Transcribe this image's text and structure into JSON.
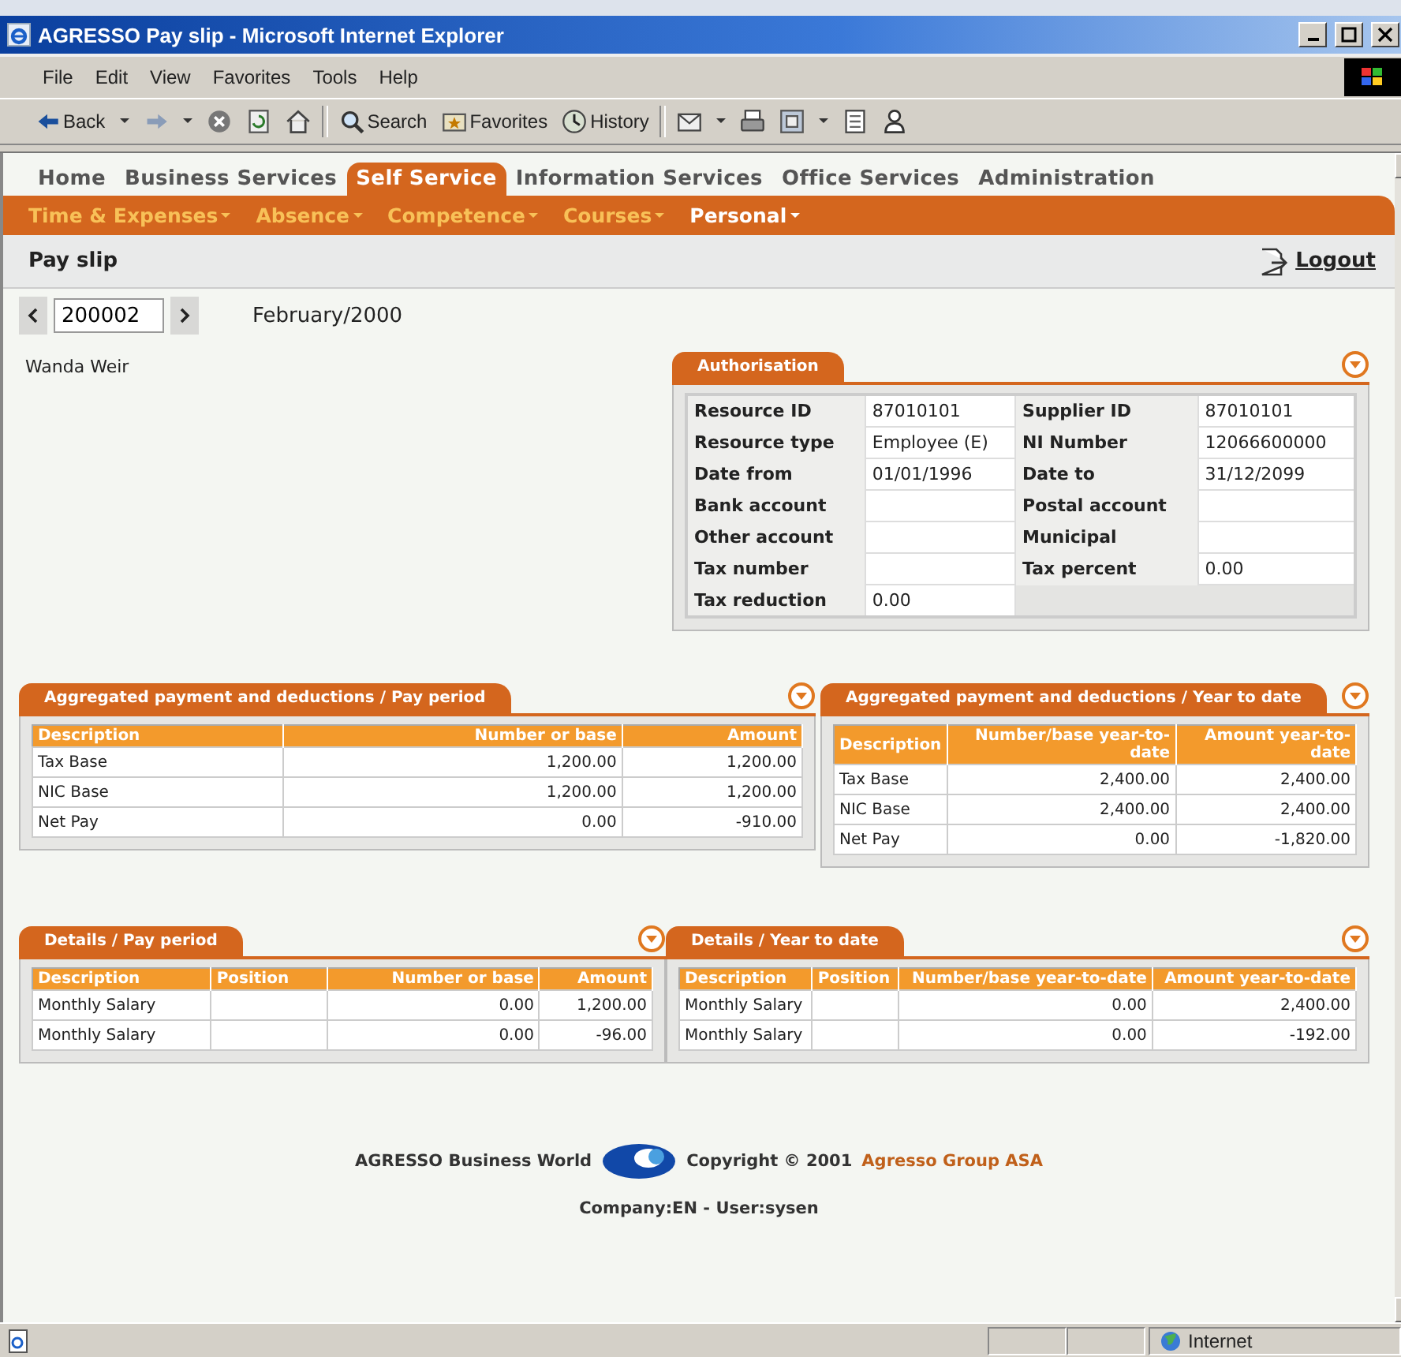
{
  "window": {
    "title": "AGRESSO Pay slip - Microsoft Internet Explorer"
  },
  "menu": [
    "File",
    "Edit",
    "View",
    "Favorites",
    "Tools",
    "Help"
  ],
  "toolbar": [
    {
      "kind": "back",
      "label": "Back"
    },
    {
      "kind": "dropdown"
    },
    {
      "kind": "forward"
    },
    {
      "kind": "dropdown"
    },
    {
      "kind": "stop"
    },
    {
      "kind": "refresh"
    },
    {
      "kind": "home"
    },
    {
      "kind": "separator"
    },
    {
      "kind": "search",
      "label": "Search"
    },
    {
      "kind": "favorites",
      "label": "Favorites"
    },
    {
      "kind": "history",
      "label": "History"
    },
    {
      "kind": "separator"
    },
    {
      "kind": "mail"
    },
    {
      "kind": "dropdown"
    },
    {
      "kind": "print"
    },
    {
      "kind": "edit"
    },
    {
      "kind": "dropdown"
    },
    {
      "kind": "discuss"
    },
    {
      "kind": "messenger"
    }
  ],
  "nav": {
    "tabs": [
      {
        "label": "Home",
        "selected": false
      },
      {
        "label": "Business Services",
        "selected": false
      },
      {
        "label": "Self Service",
        "selected": true
      },
      {
        "label": "Information Services",
        "selected": false
      },
      {
        "label": "Office Services",
        "selected": false
      },
      {
        "label": "Administration",
        "selected": false
      }
    ],
    "submenu": [
      {
        "label": "Time & Expenses",
        "selected": false
      },
      {
        "label": "Absence",
        "selected": false
      },
      {
        "label": "Competence",
        "selected": false
      },
      {
        "label": "Courses",
        "selected": false
      },
      {
        "label": "Personal",
        "selected": true
      }
    ]
  },
  "page": {
    "title": "Pay slip",
    "logout": "Logout"
  },
  "period": {
    "value": "200002",
    "label": "February/2000"
  },
  "employee": "Wanda Weir",
  "authorisation": {
    "title": "Authorisation",
    "rows": [
      [
        {
          "label": "Resource ID",
          "value": "87010101"
        },
        {
          "label": "Supplier ID",
          "value": "87010101"
        }
      ],
      [
        {
          "label": "Resource type",
          "value": "Employee (E)"
        },
        {
          "label": "NI Number",
          "value": "12066600000"
        }
      ],
      [
        {
          "label": "Date from",
          "value": "01/01/1996"
        },
        {
          "label": "Date to",
          "value": "31/12/2099"
        }
      ],
      [
        {
          "label": "Bank account"
        },
        {
          "label": "Postal account"
        }
      ],
      [
        {
          "label": "Other account"
        },
        {
          "label": "Municipal"
        }
      ],
      [
        {
          "label": "Tax number"
        },
        {
          "label": "Tax percent",
          "value": "0.00"
        }
      ],
      [
        {
          "label": "Tax reduction",
          "value": "0.00"
        }
      ]
    ]
  },
  "panels": [
    {
      "title": "Aggregated payment and deductions / Pay period",
      "columns": [
        {
          "label": "Description",
          "kind": "text"
        },
        {
          "label": "Number or base",
          "kind": "number"
        },
        {
          "label": "Amount",
          "kind": "number"
        }
      ],
      "rows": [
        [
          "Tax Base",
          "1,200.00",
          "1,200.00"
        ],
        [
          "NIC Base",
          "1,200.00",
          "1,200.00"
        ],
        [
          "Net Pay",
          "0.00",
          "-910.00"
        ]
      ]
    },
    {
      "title": "Aggregated payment and deductions / Year to date",
      "columns": [
        {
          "label": "Description",
          "kind": "text"
        },
        {
          "label": "Number/base year-to-date",
          "kind": "number"
        },
        {
          "label": "Amount year-to-date",
          "kind": "number"
        }
      ],
      "rows": [
        [
          "Tax Base",
          "2,400.00",
          "2,400.00"
        ],
        [
          "NIC Base",
          "2,400.00",
          "2,400.00"
        ],
        [
          "Net Pay",
          "0.00",
          "-1,820.00"
        ]
      ]
    },
    {
      "title": "Details / Pay period",
      "columns": [
        {
          "label": "Description",
          "kind": "text"
        },
        {
          "label": "Position",
          "kind": "text"
        },
        {
          "label": "Number or base",
          "kind": "number"
        },
        {
          "label": "Amount",
          "kind": "number"
        }
      ],
      "rows": [
        [
          "Monthly Salary",
          null,
          "0.00",
          "1,200.00"
        ],
        [
          "Monthly Salary",
          null,
          "0.00",
          "-96.00"
        ]
      ]
    },
    {
      "title": "Details / Year to date",
      "columns": [
        {
          "label": "Description",
          "kind": "text"
        },
        {
          "label": "Position",
          "kind": "text"
        },
        {
          "label": "Number/base year-to-date",
          "kind": "number"
        },
        {
          "label": "Amount year-to-date",
          "kind": "number"
        }
      ],
      "rows": [
        [
          "Monthly Salary",
          null,
          "0.00",
          "2,400.00"
        ],
        [
          "Monthly Salary",
          null,
          "0.00",
          "-192.00"
        ]
      ]
    }
  ],
  "footer": {
    "product": "AGRESSO Business World",
    "copyright": "Copyright © 2001",
    "link": "Agresso Group ASA",
    "session": "Company:EN - User:sysen"
  },
  "status_bar": {
    "zone": "Internet"
  }
}
